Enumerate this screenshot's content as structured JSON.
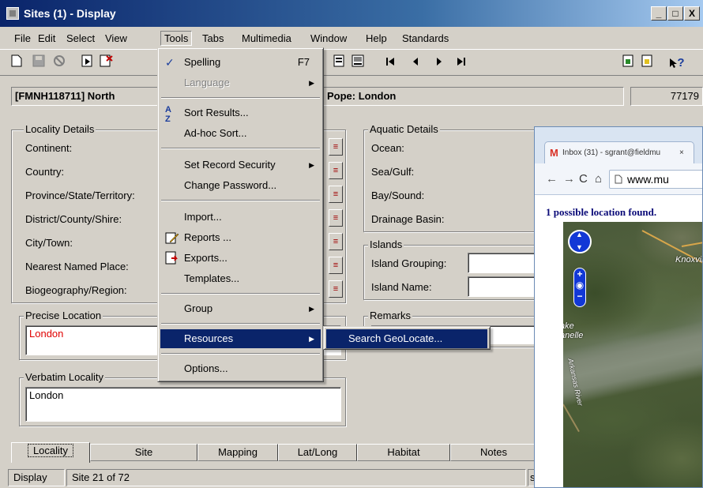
{
  "window": {
    "title": "Sites (1) - Display",
    "min": "_",
    "max": "□",
    "close": "X"
  },
  "menubar": [
    "File",
    "Edit",
    "Select",
    "View",
    "Tools",
    "Tabs",
    "Multimedia",
    "Window",
    "Help",
    "Standards"
  ],
  "toolbar": {
    "help_glyph": "?"
  },
  "record": {
    "title": "[FMNH118711] North",
    "title_right": "Pope: London",
    "number": "77179"
  },
  "locality": {
    "group": "Locality Details",
    "fields": [
      "Continent:",
      "Country:",
      "Province/State/Territory:",
      "District/County/Shire:",
      "City/Town:",
      "Nearest Named Place:",
      "Biogeography/Region:"
    ]
  },
  "precise": {
    "group": "Precise Location",
    "value": "London",
    "value_color": "#e00000"
  },
  "verbatim": {
    "group": "Verbatim Locality",
    "value": "London"
  },
  "aquatic": {
    "group": "Aquatic Details",
    "fields": [
      "Ocean:",
      "Sea/Gulf:",
      "Bay/Sound:",
      "Drainage Basin:"
    ]
  },
  "islands": {
    "group": "Islands",
    "fields": [
      "Island Grouping:",
      "Island Name:"
    ]
  },
  "remarks": {
    "group": "Remarks"
  },
  "tabs": [
    "Locality",
    "Site",
    "Mapping",
    "Lat/Long",
    "Habitat",
    "Notes"
  ],
  "status": {
    "mode": "Display",
    "position": "Site 21 of 72",
    "right": "sg"
  },
  "tools_menu": {
    "items": [
      {
        "label": "Spelling",
        "shortcut": "F7",
        "icon": "spelling-icon"
      },
      {
        "label": "Language",
        "disabled": true,
        "submenu": true
      },
      {
        "label": "Sort Results...",
        "icon": "sort-az-icon"
      },
      {
        "label": "Ad-hoc Sort..."
      },
      {
        "label": "Set Record Security",
        "submenu": true
      },
      {
        "label": "Change Password..."
      },
      {
        "label": "Import..."
      },
      {
        "label": "Reports ...",
        "icon": "reports-icon"
      },
      {
        "label": "Exports...",
        "icon": "exports-icon"
      },
      {
        "label": "Templates..."
      },
      {
        "label": "Group",
        "submenu": true
      },
      {
        "label": "Resources",
        "submenu": true,
        "highlighted": true
      },
      {
        "label": "Options..."
      }
    ],
    "submenu_item": "Search GeoLocate..."
  },
  "browser": {
    "tab_title": "Inbox (31) - sgrant@fieldmu",
    "tab_close": "×",
    "url": "www.mu",
    "result_text": "1 possible location found.",
    "map_labels": {
      "city": "Knoxvill",
      "lake1": "ake",
      "lake2": "anelle",
      "river": "Arkansas River"
    }
  },
  "colors": {
    "menu_highlight": "#0a246a",
    "title_start": "#0a246a",
    "title_end": "#a6caf0"
  }
}
